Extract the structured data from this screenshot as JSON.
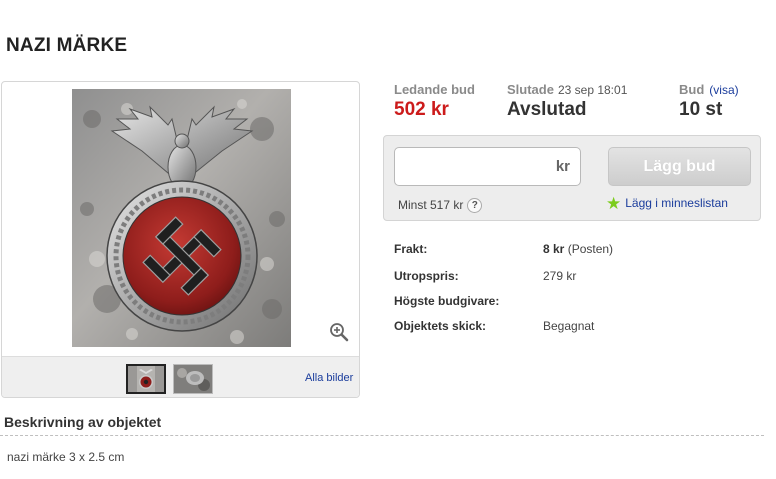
{
  "title": "NAZI MÄRKE",
  "gallery": {
    "main_image_icon": "emblem-badge-photo",
    "zoom_icon": "magnifier-plus-icon",
    "thumbnails": [
      "thumbnail-front",
      "thumbnail-side"
    ],
    "all_images_label": "Alla bilder"
  },
  "summary": {
    "leading_label": "Ledande bud",
    "leading_value": "502 kr",
    "ended_label": "Slutade",
    "ended_date": "23 sep 18:01",
    "ended_value": "Avslutad",
    "bids_label": "Bud",
    "bids_link": "(visa)",
    "bids_value": "10 st",
    "colors": {
      "price": "#cc1b1b",
      "link": "#1a3c9c"
    }
  },
  "bid": {
    "input_value": "",
    "currency": "kr",
    "button_label": "Lägg bud",
    "min_label": "Minst 517 kr",
    "help_glyph": "?",
    "watch_label": "Lägg i minneslistan",
    "star_color": "#7ccc1c"
  },
  "details": {
    "shipping_label": "Frakt:",
    "shipping_price": "8 kr",
    "shipping_method": "(Posten)",
    "start_price_label": "Utropspris:",
    "start_price": "279 kr",
    "top_bidder_label": "Högste budgivare:",
    "top_bidder": "",
    "condition_label": "Objektets skick:",
    "condition": "Begagnat"
  },
  "description": {
    "heading": "Beskrivning av objektet",
    "text": "nazi märke 3 x 2.5 cm"
  }
}
